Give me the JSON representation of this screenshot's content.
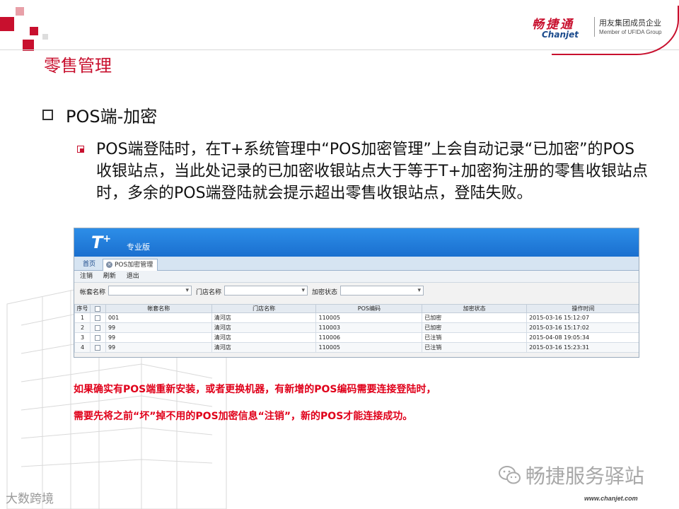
{
  "brand": {
    "name_cn": "畅捷通",
    "name_en": "Chanjet",
    "tagline_cn": "用友集团成员企业",
    "tagline_en": "Member of UFIDA Group"
  },
  "section_title": "零售管理",
  "bullet1": "POS端-加密",
  "bullet2": "POS端登陆时，在T+系统管理中“POS加密管理”上会自动记录“已加密”的POS收银站点，当此处记录的已加密收银站点大于等于T+加密狗注册的零售收银站点时，多余的POS端登陆就会提示超出零售收银站点，登陆失败。",
  "app": {
    "logo": "T",
    "logo_sup": "+",
    "edition": "专业版",
    "tabs": {
      "home": "首页",
      "active": "POS加密管理"
    },
    "toolbar": {
      "logout": "注销",
      "refresh": "刷新",
      "exit": "退出"
    },
    "filters": {
      "account": "帐套名称",
      "store": "门店名称",
      "status": "加密状态"
    },
    "columns": [
      "序号",
      "",
      "帐套名称",
      "门店名称",
      "POS编码",
      "加密状态",
      "操作时间"
    ],
    "rows": [
      {
        "no": "1",
        "account": "001",
        "store": "清河店",
        "pos": "110005",
        "status": "已加密",
        "time": "2015-03-16 15:12:07"
      },
      {
        "no": "2",
        "account": "99",
        "store": "清河店",
        "pos": "110003",
        "status": "已加密",
        "time": "2015-03-16 15:17:02"
      },
      {
        "no": "3",
        "account": "99",
        "store": "清河店",
        "pos": "110006",
        "status": "已注销",
        "time": "2015-04-08 19:05:34"
      },
      {
        "no": "4",
        "account": "99",
        "store": "清河店",
        "pos": "110005",
        "status": "已注销",
        "time": "2015-03-16 15:23:31"
      }
    ],
    "colors": {
      "header": "#1a6fcf"
    }
  },
  "note1": "如果确实有POS端重新安装，或者更换机器，有新增的POS编码需要连接登陆时，",
  "note2": "需要先将之前“坏”掉不用的POS加密信息“注销”，新的POS才能连接成功。",
  "wechat_label": "畅捷服务驿站",
  "website": "www.chanjet.com",
  "watermark": "大数跨境",
  "colors": {
    "accent": "#c8102e",
    "note": "#e0001a"
  }
}
